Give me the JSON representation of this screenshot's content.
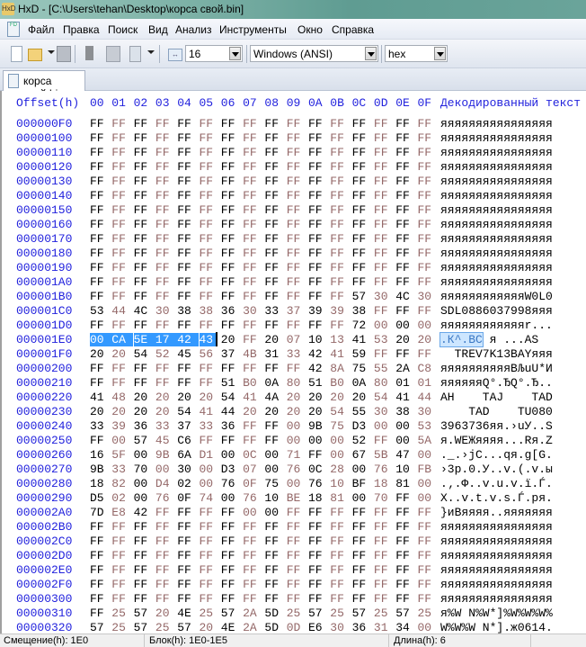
{
  "window": {
    "title": "HxD - [C:\\Users\\tehan\\Desktop\\корса свой.bin]"
  },
  "menu": [
    "Файл",
    "Правка",
    "Поиск",
    "Вид",
    "Анализ",
    "Инструменты",
    "Окно",
    "Справка"
  ],
  "toolbar": {
    "bytes_per_row": "16",
    "charset": "Windows (ANSI)",
    "offset_base": "hex"
  },
  "tab": {
    "label": "корса свой.bin"
  },
  "header": {
    "offset_label": "Offset(h)",
    "columns": [
      "00",
      "01",
      "02",
      "03",
      "04",
      "05",
      "06",
      "07",
      "08",
      "09",
      "0A",
      "0B",
      "0C",
      "0D",
      "0E",
      "0F"
    ],
    "decoded_label": "Декодированный текст"
  },
  "selection": {
    "row": "000001E0",
    "start_col": 0,
    "length": 6
  },
  "rows": [
    {
      "offset": "000000F0",
      "bytes": "FF FF FF FF FF FF FF FF FF FF FF FF FF FF FF FF",
      "text": "яяяяяяяяяяяяяяяя"
    },
    {
      "offset": "00000100",
      "bytes": "FF FF FF FF FF FF FF FF FF FF FF FF FF FF FF FF",
      "text": "яяяяяяяяяяяяяяяя"
    },
    {
      "offset": "00000110",
      "bytes": "FF FF FF FF FF FF FF FF FF FF FF FF FF FF FF FF",
      "text": "яяяяяяяяяяяяяяяя"
    },
    {
      "offset": "00000120",
      "bytes": "FF FF FF FF FF FF FF FF FF FF FF FF FF FF FF FF",
      "text": "яяяяяяяяяяяяяяяя"
    },
    {
      "offset": "00000130",
      "bytes": "FF FF FF FF FF FF FF FF FF FF FF FF FF FF FF FF",
      "text": "яяяяяяяяяяяяяяяя"
    },
    {
      "offset": "00000140",
      "bytes": "FF FF FF FF FF FF FF FF FF FF FF FF FF FF FF FF",
      "text": "яяяяяяяяяяяяяяяя"
    },
    {
      "offset": "00000150",
      "bytes": "FF FF FF FF FF FF FF FF FF FF FF FF FF FF FF FF",
      "text": "яяяяяяяяяяяяяяяя"
    },
    {
      "offset": "00000160",
      "bytes": "FF FF FF FF FF FF FF FF FF FF FF FF FF FF FF FF",
      "text": "яяяяяяяяяяяяяяяя"
    },
    {
      "offset": "00000170",
      "bytes": "FF FF FF FF FF FF FF FF FF FF FF FF FF FF FF FF",
      "text": "яяяяяяяяяяяяяяяя"
    },
    {
      "offset": "00000180",
      "bytes": "FF FF FF FF FF FF FF FF FF FF FF FF FF FF FF FF",
      "text": "яяяяяяяяяяяяяяяя"
    },
    {
      "offset": "00000190",
      "bytes": "FF FF FF FF FF FF FF FF FF FF FF FF FF FF FF FF",
      "text": "яяяяяяяяяяяяяяяя"
    },
    {
      "offset": "000001A0",
      "bytes": "FF FF FF FF FF FF FF FF FF FF FF FF FF FF FF FF",
      "text": "яяяяяяяяяяяяяяяя"
    },
    {
      "offset": "000001B0",
      "bytes": "FF FF FF FF FF FF FF FF FF FF FF FF 57 30 4C 30",
      "text": "яяяяяяяяяяяяW0L0"
    },
    {
      "offset": "000001C0",
      "bytes": "53 44 4C 30 38 38 36 30 33 37 39 39 38 FF FF FF",
      "text": "SDL0886037998яяя"
    },
    {
      "offset": "000001D0",
      "bytes": "FF FF FF FF FF FF FF FF FF FF FF FF 72 00 00 00",
      "text": "яяяяяяяяяяяяr..."
    },
    {
      "offset": "000001E0",
      "bytes": "00 CA 5E 17 42 43 20 FF 20 07 10 13 41 53 20 20",
      "text": ".К^.BC я ...AS  "
    },
    {
      "offset": "000001F0",
      "bytes": "20 20 54 52 45 56 37 4B 31 33 42 41 59 FF FF FF",
      "text": "  TREV7K13BAYяяя"
    },
    {
      "offset": "00000200",
      "bytes": "FF FF FF FF FF FF FF FF FF FF 42 8A 75 55 2A C8",
      "text": "яяяяяяяяяяBЉuU*И"
    },
    {
      "offset": "00000210",
      "bytes": "FF FF FF FF FF FF 51 B0 0A 80 51 B0 0A 80 01 01",
      "text": "яяяяяяQ°.ЂQ°.Ђ.."
    },
    {
      "offset": "00000220",
      "bytes": "41 48 20 20 20 20 54 41 4A 20 20 20 20 54 41 44",
      "text": "AH    TAJ    TAD"
    },
    {
      "offset": "00000230",
      "bytes": "20 20 20 20 54 41 44 20 20 20 20 54 55 30 38 30",
      "text": "    TAD    TU080"
    },
    {
      "offset": "00000240",
      "bytes": "33 39 36 33 37 33 36 FF FF 00 9B 75 D3 00 00 53",
      "text": "3963736яя.›uУ..S"
    },
    {
      "offset": "00000250",
      "bytes": "FF 00 57 45 C6 FF FF FF FF 00 00 00 52 FF 00 5A",
      "text": "я.WEЖяяяя...Rя.Z"
    },
    {
      "offset": "00000260",
      "bytes": "16 5F 00 9B 6A D1 00 0C 00 71 FF 00 67 5B 47 00",
      "text": "._.›jС...qя.g[G."
    },
    {
      "offset": "00000270",
      "bytes": "9B 33 70 00 30 00 D3 07 00 76 0C 28 00 76 10 FB",
      "text": "›3p.0.У..v.(.v.ы"
    },
    {
      "offset": "00000280",
      "bytes": "18 82 00 D4 02 00 76 0F 75 00 76 10 BF 18 81 00",
      "text": ".‚.Ф..v.u.v.ї.Ѓ."
    },
    {
      "offset": "00000290",
      "bytes": "D5 02 00 76 0F 74 00 76 10 BE 18 81 00 70 FF 00",
      "text": "Х..v.t.v.ѕ.Ѓ.pя."
    },
    {
      "offset": "000002A0",
      "bytes": "7D E8 42 FF FF FF FF 00 00 FF FF FF FF FF FF FF",
      "text": "}иBяяяя..яяяяяяя"
    },
    {
      "offset": "000002B0",
      "bytes": "FF FF FF FF FF FF FF FF FF FF FF FF FF FF FF FF",
      "text": "яяяяяяяяяяяяяяяя"
    },
    {
      "offset": "000002C0",
      "bytes": "FF FF FF FF FF FF FF FF FF FF FF FF FF FF FF FF",
      "text": "яяяяяяяяяяяяяяяя"
    },
    {
      "offset": "000002D0",
      "bytes": "FF FF FF FF FF FF FF FF FF FF FF FF FF FF FF FF",
      "text": "яяяяяяяяяяяяяяяя"
    },
    {
      "offset": "000002E0",
      "bytes": "FF FF FF FF FF FF FF FF FF FF FF FF FF FF FF FF",
      "text": "яяяяяяяяяяяяяяяя"
    },
    {
      "offset": "000002F0",
      "bytes": "FF FF FF FF FF FF FF FF FF FF FF FF FF FF FF FF",
      "text": "яяяяяяяяяяяяяяяя"
    },
    {
      "offset": "00000300",
      "bytes": "FF FF FF FF FF FF FF FF FF FF FF FF FF FF FF FF",
      "text": "яяяяяяяяяяяяяяяя"
    },
    {
      "offset": "00000310",
      "bytes": "FF 25 57 20 4E 25 57 2A 5D 25 57 25 57 25 57 25",
      "text": "я%W N%W*]%W%W%W%"
    },
    {
      "offset": "00000320",
      "bytes": "57 25 57 25 57 20 4E 2A 5D 0D E6 30 36 31 34 00",
      "text": "W%W%W N*].ж0614."
    }
  ],
  "status": {
    "offset": "Смещение(h): 1E0",
    "block": "Блок(h): 1E0-1E5",
    "length": "Длина(h): 6"
  },
  "colors": {
    "offset_text": "#2222dd",
    "odd_byte": "#946868",
    "selection": "#3399ff"
  }
}
